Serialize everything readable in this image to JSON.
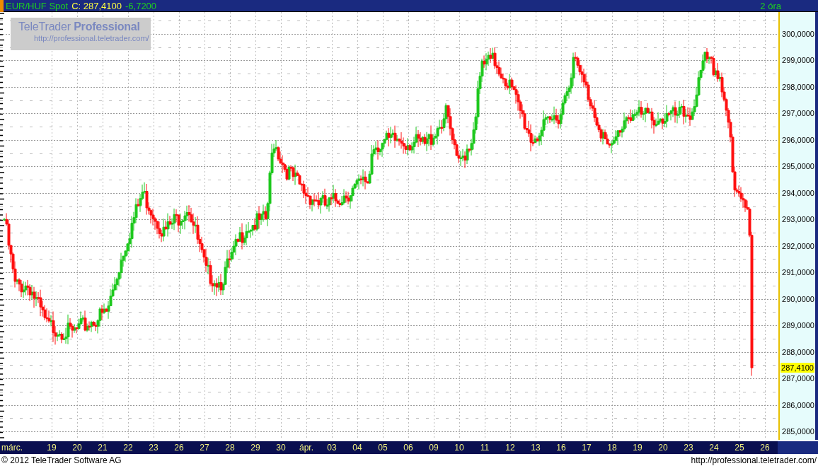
{
  "header": {
    "symbol": "EUR/HUF Spot",
    "close": "C: 287,4100",
    "change": "-6,7200",
    "interval": "2 óra"
  },
  "logo": {
    "title": "TeleTrader **Professional**",
    "url": "http://professional.teletrader.com/"
  },
  "price_axis": {
    "labels": [
      "300,0000",
      "299,0000",
      "298,0000",
      "297,0000",
      "296,0000",
      "295,0000",
      "294,0000",
      "293,0000",
      "292,0000",
      "291,0000",
      "290,0000",
      "289,0000",
      "288,0000",
      "287,0000",
      "286,0000",
      "285,0000"
    ],
    "last_price": "287,4100"
  },
  "time_axis": {
    "labels": [
      "márc.",
      "19",
      "20",
      "21",
      "22",
      "23",
      "26",
      "27",
      "28",
      "29",
      "30",
      "ápr.",
      "03",
      "04",
      "05",
      "06",
      "09",
      "10",
      "11",
      "12",
      "13",
      "16",
      "17",
      "18",
      "19",
      "20",
      "23",
      "24",
      "25",
      "26"
    ]
  },
  "footer": {
    "copyright": "© 2012 TeleTrader Software AG",
    "url": "http://professional.teletrader.com/"
  }
}
